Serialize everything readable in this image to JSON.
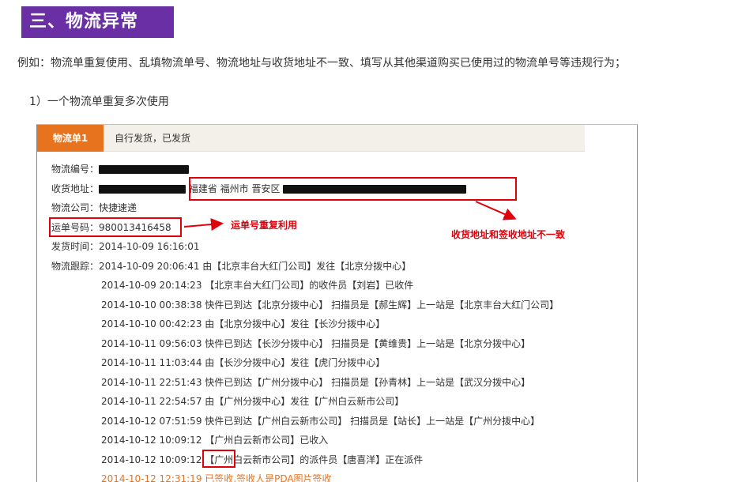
{
  "section_title": "三、物流异常",
  "intro_text": "例如：物流单重复使用、乱填物流单号、物流地址与收货地址不一致、填写从其他渠道购买已使用过的物流单号等违规行为；",
  "subheading": "1）一个物流单重复多次使用",
  "screenshot": {
    "tab_label": "物流单1",
    "tab_status": "自行发货，已发货",
    "fields": {
      "logistics_no_label": "物流编号：",
      "address_label": "收货地址：",
      "address_visible": "福建省 福州市 晋安区",
      "company_label": "物流公司：",
      "company_value": "快捷速递",
      "waybill_label": "运单号码：",
      "waybill_value": "980013416458",
      "ship_time_label": "发货时间：",
      "ship_time_value": "2014-10-09 16:16:01",
      "tracking_label": "物流跟踪："
    },
    "tracking": [
      "2014-10-09 20:06:41 由【北京丰台大红门公司】发往【北京分拨中心】",
      "2014-10-09 20:14:23 【北京丰台大红门公司】的收件员【刘岩】已收件",
      "2014-10-10 00:38:38 快件已到达【北京分拨中心】 扫描员是【郝生辉】上一站是【北京丰台大红门公司】",
      "2014-10-10 00:42:23 由【北京分拨中心】发往【长沙分拨中心】",
      "2014-10-11 09:56:03 快件已到达【长沙分拨中心】 扫描员是【黄维贵】上一站是【北京分拨中心】",
      "2014-10-11 11:03:44 由【长沙分拨中心】发往【虎门分拨中心】",
      "2014-10-11 22:51:43 快件已到达【广州分拨中心】 扫描员是【孙青林】上一站是【武汉分拨中心】",
      "2014-10-11 22:54:57 由【广州分拨中心】发往【广州白云新市公司】",
      "2014-10-12 07:51:59 快件已到达【广州白云新市公司】 扫描员是【站长】上一站是【广州分拨中心】",
      "2014-10-12 10:09:12 【广州白云新市公司】已收入",
      "2014-10-12 10:09:12 【广州白云新市公司】的派件员【唐喜洋】正在派件",
      "2014-10-12 12:31:19 已签收,签收人是PDA图片签收"
    ],
    "annotations": {
      "waybill_reused": "运单号重复利用",
      "address_mismatch": "收货地址和签收地址不一致"
    },
    "colors": {
      "accent_orange": "#e8731f",
      "annotation_red": "#e0000b",
      "title_purple": "#6b2fa5"
    }
  }
}
